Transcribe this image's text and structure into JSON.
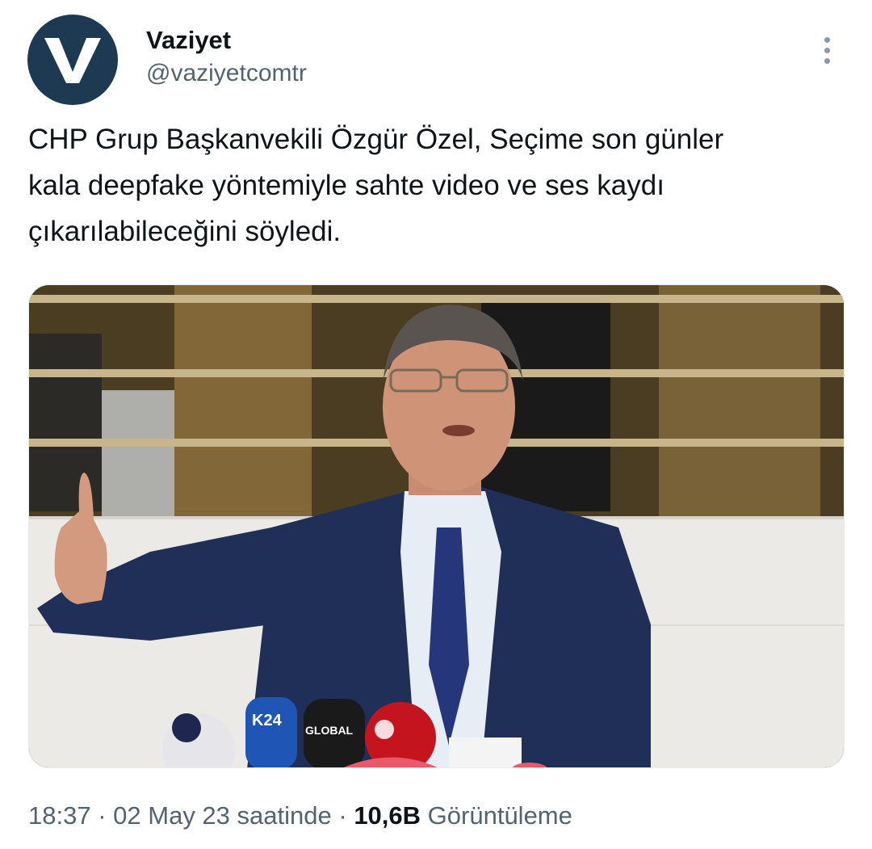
{
  "author": {
    "display_name": "Vaziyet",
    "handle": "@vaziyetcomtr",
    "avatar_icon": "vaziyet-v-logo",
    "avatar_bg": "#1d3a52"
  },
  "more_options_icon": "vertical-ellipsis-icon",
  "tweet": {
    "text": "CHP Grup Başkanvekili Özgür Özel, Seçime son günler\nkala deepfake yöntemiyle sahte video ve ses kaydı\nçıkarılabileceğini söyledi."
  },
  "media": {
    "microphone_labels": [
      "K24",
      "GLOBAL"
    ]
  },
  "meta": {
    "time": "18:37",
    "separator": "·",
    "date": "02 May 23 saatinde",
    "views_count": "10,6B",
    "views_label": "Görüntüleme"
  },
  "colors": {
    "text_primary": "#0f1419",
    "text_secondary": "#536471"
  }
}
